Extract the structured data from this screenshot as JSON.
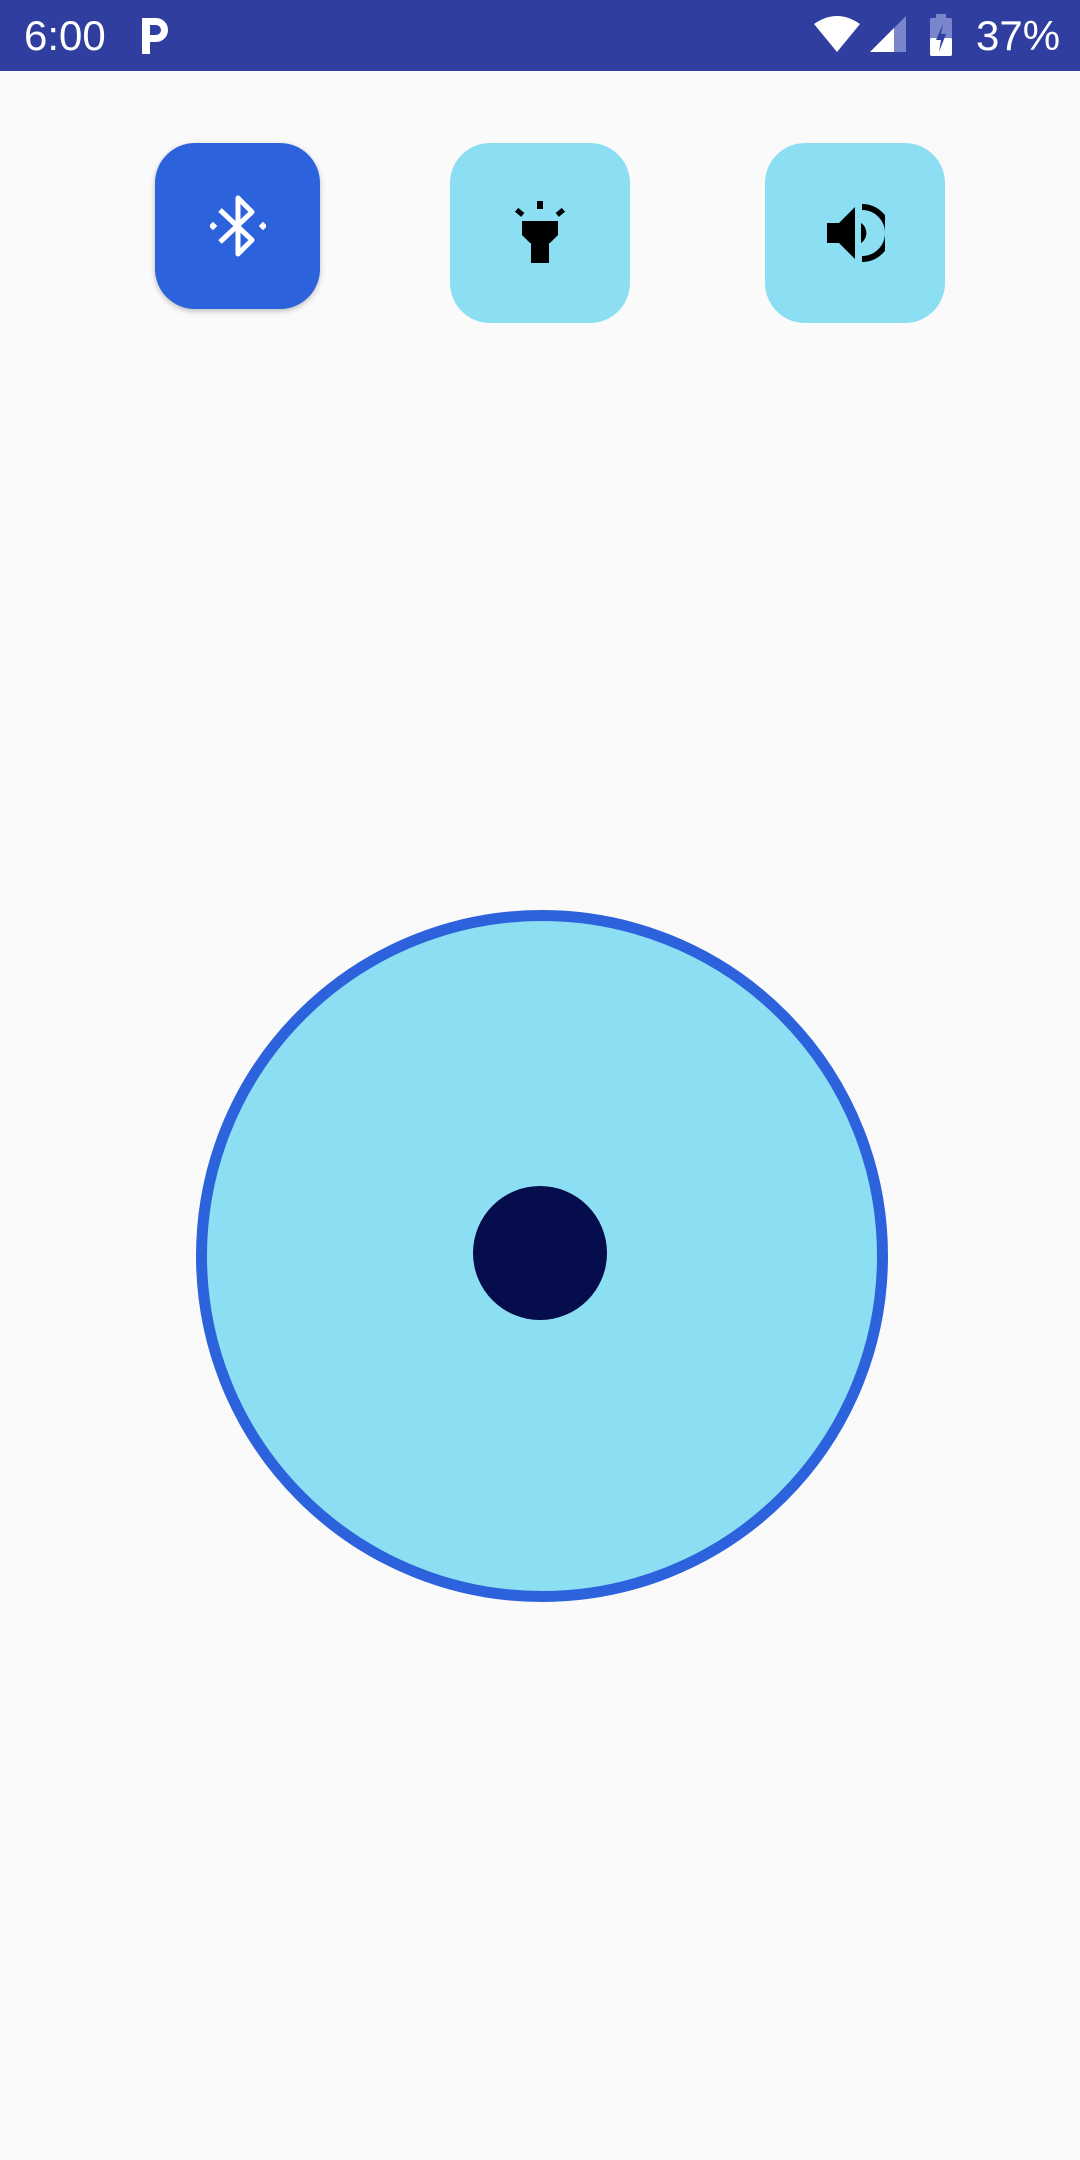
{
  "status_bar": {
    "time": "6:00",
    "battery": "37%",
    "background_color": "#303f9f",
    "icons": [
      "parking-app-icon",
      "wifi-icon",
      "cell-signal-icon",
      "battery-charging-icon"
    ]
  },
  "toggles": [
    {
      "id": "bluetooth",
      "icon": "bluetooth-icon",
      "active": true,
      "color": "#2d62dd"
    },
    {
      "id": "flashlight",
      "icon": "flashlight-icon",
      "active": false,
      "color": "#8cdff2"
    },
    {
      "id": "sound",
      "icon": "volume-icon",
      "active": false,
      "color": "#8cdff2"
    }
  ],
  "joystick": {
    "base_color": "#8cdff2",
    "border_color": "#2d62dd",
    "knob_color": "#050d4d",
    "knob_offset": {
      "x": 0,
      "y": 0
    }
  }
}
